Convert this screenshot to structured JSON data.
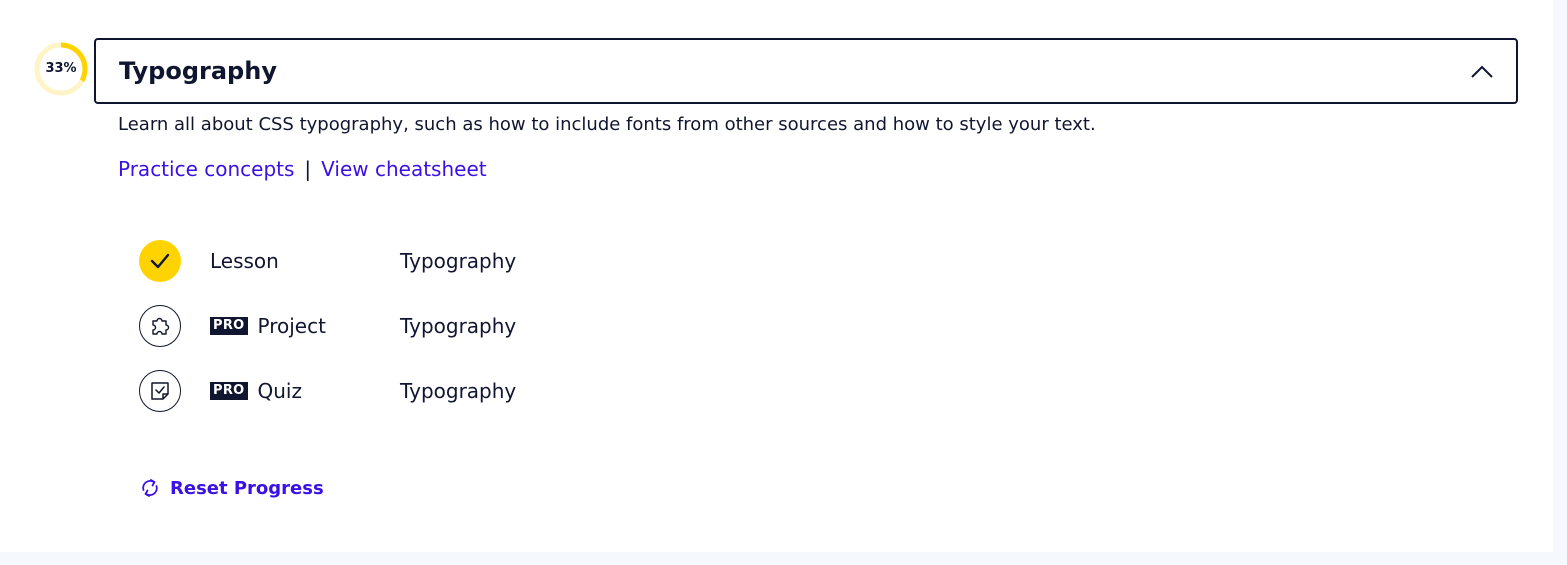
{
  "module": {
    "title": "Typography",
    "progress": {
      "label": "33%",
      "value": 0.33,
      "track_color": "#fff4c6",
      "fill_color": "#ffd300"
    },
    "expanded": true,
    "description": "Learn all about CSS typography, such as how to include fonts from other sources and how to style your text.",
    "links": {
      "practice_label": "Practice concepts",
      "separator": "|",
      "cheatsheet_label": "View cheatsheet"
    },
    "items": [
      {
        "type": "Lesson",
        "pro": false,
        "name": "Typography",
        "status": "completed",
        "icon": "checkmark-icon"
      },
      {
        "type": "Project",
        "pro": true,
        "pro_label": "PRO",
        "name": "Typography",
        "status": "not-started",
        "icon": "puzzle-icon"
      },
      {
        "type": "Quiz",
        "pro": true,
        "pro_label": "PRO",
        "name": "Typography",
        "status": "not-started",
        "icon": "quiz-icon"
      }
    ],
    "reset_label": "Reset Progress"
  },
  "colors": {
    "accent_link": "#3a10e5",
    "text": "#10162f",
    "complete": "#ffd300",
    "page_bg": "#f5f8fd"
  }
}
